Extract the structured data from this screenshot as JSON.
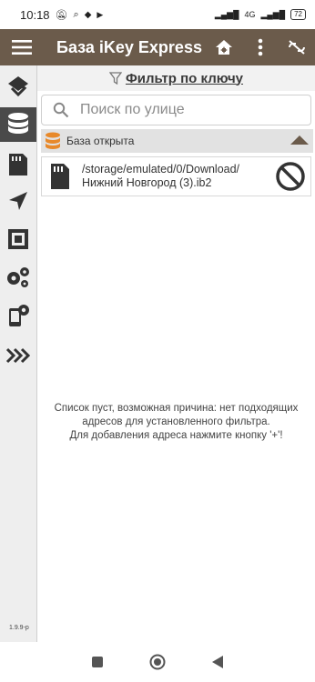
{
  "status_bar": {
    "time": "10:18",
    "network": "4G",
    "battery": "72"
  },
  "app_bar": {
    "title": "База iKey Express",
    "menu_icon": "hamburger-icon",
    "home_icon": "home-icon",
    "more_icon": "more-vert-icon",
    "unlink_icon": "link-off-icon"
  },
  "filter": {
    "label": "Фильтр по ключу",
    "icon": "filter-icon"
  },
  "search": {
    "placeholder": "Поиск по улице"
  },
  "db_section": {
    "label": "База открыта",
    "icon": "database-icon"
  },
  "db_item": {
    "path": "/storage/emulated/0/Download/\nНижний Новгород (3).ib2",
    "icon": "sd-card-icon",
    "action_icon": "block-icon"
  },
  "empty_message": "Список пуст, возможная причина: нет подходящих адресов для установленного фильтра.\nДля добавления адреса нажмите кнопку '+'!",
  "sidebar": {
    "version": "1.9.9-p"
  },
  "colors": {
    "appbar": "#6b5b4b",
    "accent": "#e8892a",
    "sidebar_active": "#4a4a4a"
  }
}
